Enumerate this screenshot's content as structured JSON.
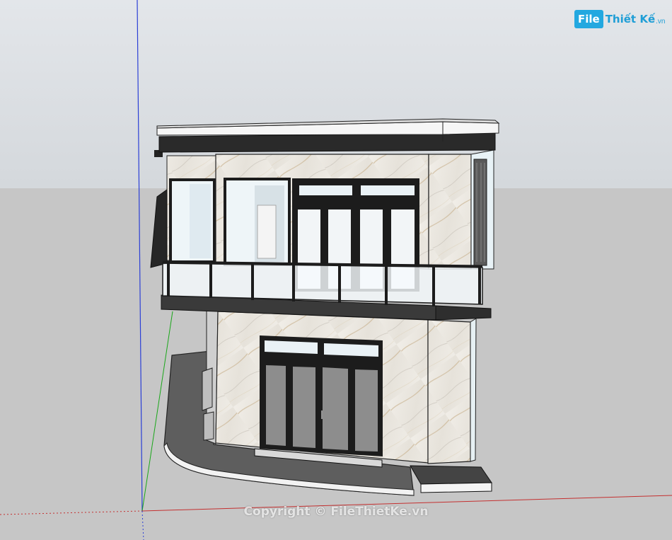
{
  "branding": {
    "logo_badge": "File",
    "logo_name": "Thiết Kế",
    "logo_tld": ".vn"
  },
  "watermark": {
    "text": "Copyright © FileThietKe.vn"
  },
  "scene": {
    "axis_colors": {
      "blue": "#2b3fd6",
      "green": "#1aa71a",
      "red": "#c43030"
    },
    "colors": {
      "sky": "#dfe2e6",
      "ground": "#c6c6c6",
      "marble": "#ece9e2",
      "frame": "#1e1e1e",
      "glass": "#e9f3f8",
      "slab": "#3a3a3a",
      "plinth": "#6e6e6e"
    }
  }
}
